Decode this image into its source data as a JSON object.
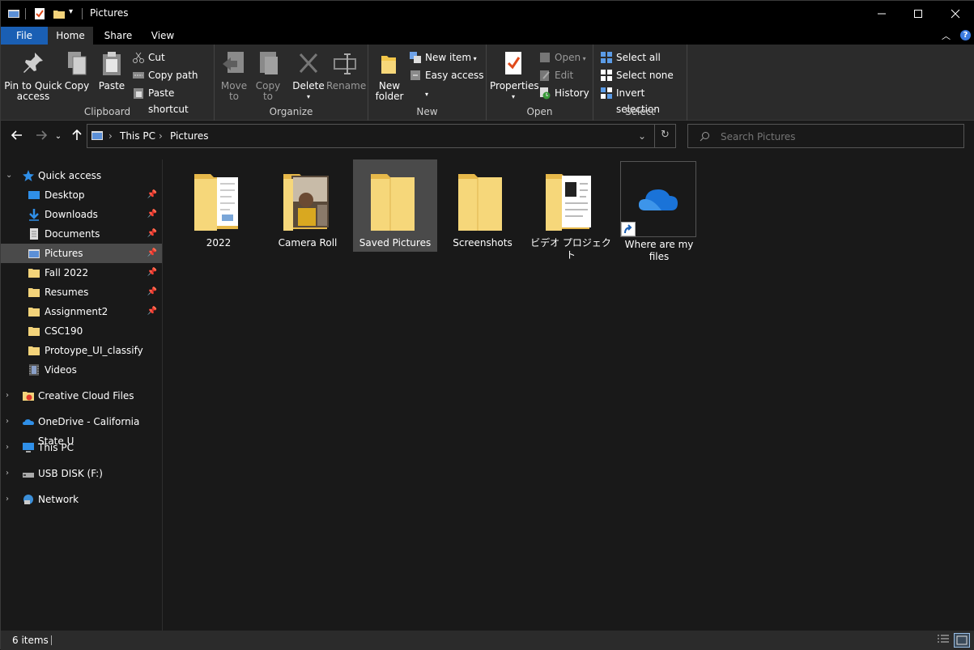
{
  "window": {
    "title": "Pictures"
  },
  "tabs": {
    "file": "File",
    "home": "Home",
    "share": "Share",
    "view": "View"
  },
  "ribbon": {
    "clipboard": {
      "label": "Clipboard",
      "pin_l1": "Pin to Quick",
      "pin_l2": "access",
      "copy": "Copy",
      "paste": "Paste",
      "cut": "Cut",
      "copy_path": "Copy path",
      "paste_shortcut": "Paste shortcut"
    },
    "organize": {
      "label": "Organize",
      "move_l1": "Move",
      "move_l2": "to",
      "copy_l1": "Copy",
      "copy_l2": "to",
      "delete": "Delete",
      "rename": "Rename"
    },
    "new": {
      "label": "New",
      "new_folder_l1": "New",
      "new_folder_l2": "folder",
      "new_item": "New item",
      "easy_access": "Easy access"
    },
    "open": {
      "label": "Open",
      "properties": "Properties",
      "open": "Open",
      "edit": "Edit",
      "history": "History"
    },
    "select": {
      "label": "Select",
      "select_all": "Select all",
      "select_none": "Select none",
      "invert": "Invert selection"
    }
  },
  "address": {
    "crumbs": [
      "This PC",
      "Pictures"
    ]
  },
  "search": {
    "placeholder": "Search Pictures"
  },
  "nav": {
    "quick_access": "Quick access",
    "items": [
      {
        "label": "Desktop",
        "pinned": true
      },
      {
        "label": "Downloads",
        "pinned": true
      },
      {
        "label": "Documents",
        "pinned": true
      },
      {
        "label": "Pictures",
        "pinned": true
      },
      {
        "label": "Fall 2022",
        "pinned": true
      },
      {
        "label": "Resumes",
        "pinned": true
      },
      {
        "label": "Assignment2",
        "pinned": true
      },
      {
        "label": "CSC190",
        "pinned": false
      },
      {
        "label": "Protoype_UI_classify",
        "pinned": false
      },
      {
        "label": "Videos",
        "pinned": false
      }
    ],
    "roots": [
      "Creative Cloud Files",
      "OneDrive - California State U",
      "This PC",
      "USB DISK (F:)",
      "Network"
    ]
  },
  "files": [
    {
      "label": "2022"
    },
    {
      "label": "Camera Roll"
    },
    {
      "label": "Saved Pictures"
    },
    {
      "label": "Screenshots"
    },
    {
      "label": "ビデオ プロジェクト"
    },
    {
      "label": "Where are my files"
    }
  ],
  "status": {
    "count": "6 items"
  }
}
